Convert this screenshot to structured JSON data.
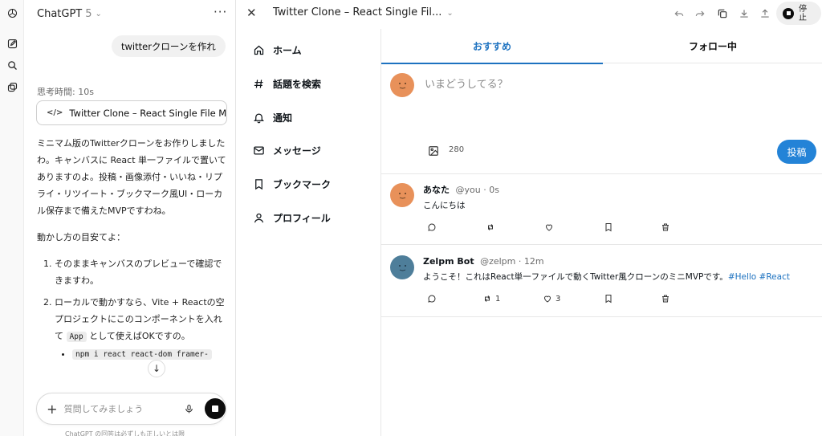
{
  "rail": {
    "icons": [
      "openai-logo-icon",
      "new-chat-icon",
      "search-icon",
      "library-icon"
    ]
  },
  "chat": {
    "title": "ChatGPT",
    "version": "5",
    "user_message": "twitterクローンを作れ",
    "thinking": "思考時間: 10s",
    "canvas_chip": "Twitter Clone – React Single File Mvp",
    "reply_p1": "ミニマム版のTwitterクローンをお作りしましたわ。キャンバスに React 単一ファイルで置いてありますのよ。投稿・画像添付・いいね・リプライ・リツイート・ブックマーク風UI・ローカル保存まで備えたMVPですわね。",
    "reply_p2": "動かし方の目安てよ：",
    "step1": "そのままキャンバスのプレビューで確認できますわ。",
    "step2_a": "ローカルで動かすなら、Vite + Reactの空プロジェクトにこのコンポーネントを入れて",
    "step2_code": "App",
    "step2_b": "として使えばOKですの。",
    "bullet_code": "npm i react react-dom framer-",
    "composer_placeholder": "質問してみましょう",
    "disclaimer": "ChatGPT の回答は必ずしも正しいとは限"
  },
  "canvas": {
    "title": "Twitter Clone – React Single Fil...",
    "stop_label": "停止"
  },
  "twitter": {
    "nav": [
      {
        "label": "ホーム",
        "icon": "home-icon"
      },
      {
        "label": "話題を検索",
        "icon": "hashtag-icon"
      },
      {
        "label": "通知",
        "icon": "bell-icon"
      },
      {
        "label": "メッセージ",
        "icon": "mail-icon"
      },
      {
        "label": "ブックマーク",
        "icon": "bookmark-icon"
      },
      {
        "label": "プロフィール",
        "icon": "user-icon"
      }
    ],
    "tabs": {
      "recommended": "おすすめ",
      "following": "フォロー中"
    },
    "compose": {
      "placeholder": "いまどうしてる？",
      "counter": "280",
      "post_label": "投稿"
    },
    "tweets": [
      {
        "name": "あなた",
        "meta": "@you · 0s",
        "text": "こんにちは",
        "tags": "",
        "retweets": "",
        "likes": ""
      },
      {
        "name": "Zelpm Bot",
        "meta": "@zelpm · 12m",
        "text": "ようこそ！これはReact単一ファイルで動くTwitter風クローンのミニMVPです。",
        "tags": "#Hello #React",
        "retweets": "1",
        "likes": "3"
      }
    ]
  },
  "colors": {
    "accent": "#1d72c0",
    "post_button": "#2383d7",
    "avatar_orange": "#e8915a",
    "avatar_blue": "#4e7e9a"
  }
}
